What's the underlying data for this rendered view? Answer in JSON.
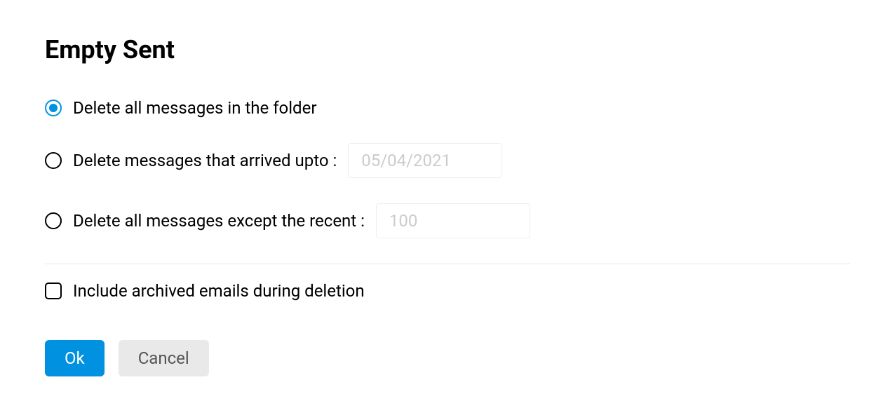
{
  "dialog": {
    "title": "Empty Sent"
  },
  "options": {
    "delete_all": {
      "label": "Delete all messages in the folder",
      "selected": true
    },
    "delete_upto": {
      "label": "Delete messages that arrived upto :",
      "selected": false,
      "date_placeholder": "05/04/2021",
      "date_value": ""
    },
    "delete_except_recent": {
      "label": "Delete all messages except the recent :",
      "selected": false,
      "count_placeholder": "100",
      "count_value": ""
    }
  },
  "checkbox": {
    "include_archived": {
      "label": "Include archived emails during deletion",
      "checked": false
    }
  },
  "buttons": {
    "ok": "Ok",
    "cancel": "Cancel"
  }
}
